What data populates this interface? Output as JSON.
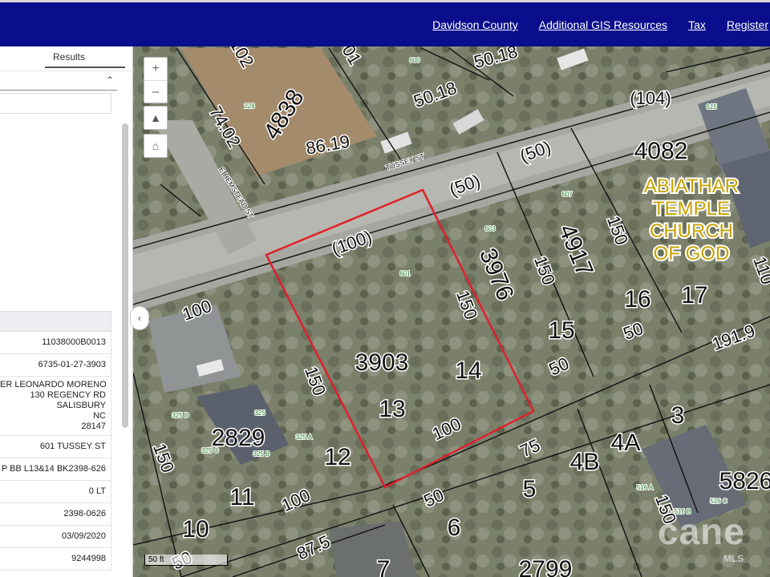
{
  "header": {
    "nav": [
      "Davidson County",
      "Additional GIS Resources",
      "Tax",
      "Register"
    ]
  },
  "sidebar": {
    "tab_label": "Results",
    "attributes": [
      "11038000B0013",
      "6735-01-27-3903",
      "ER LEONARDO MORENO",
      "130 REGENCY RD",
      "SALISBURY",
      "NC",
      "28147",
      "601 TUSSEY ST",
      "P BB L13&14 BK2398-626",
      "0 LT",
      "2398-0626",
      "03/09/2020",
      "9244998"
    ]
  },
  "map": {
    "scale_label": "50 ft",
    "watermark": "cane",
    "watermark_sub": "MLS",
    "street_labels": [
      "TUSSEY ST",
      "E HEMSTEAD ST"
    ],
    "church_label": [
      "ABIATHAR",
      "TEMPLE",
      "CHURCH",
      "OF GOD"
    ],
    "parcel_numbers": [
      "4838",
      "4082",
      "3976",
      "4917",
      "3903",
      "2829",
      "5826",
      "2799"
    ],
    "lot_numbers": [
      "16",
      "17",
      "15",
      "14",
      "13",
      "12",
      "11",
      "10",
      "3",
      "4A",
      "4B",
      "5",
      "6",
      "7"
    ],
    "dimensions": [
      "74.02",
      "86.19",
      "50.18",
      "50.18",
      "(104)",
      "(50)",
      "(50)",
      "(100)",
      "150",
      "150",
      "150",
      "150",
      "150",
      "100",
      "50",
      "50",
      "191.9",
      "100",
      "75",
      "50",
      "100",
      "150",
      "87.5",
      "50",
      "102",
      "01",
      "110"
    ],
    "address_labels": [
      "600",
      "228",
      "615",
      "607",
      "603",
      "601",
      "325 D",
      "325",
      "325 A",
      "325 C",
      "325 B",
      "516 A",
      "516 B",
      "516 C"
    ],
    "highlight_color": "#e0202a"
  }
}
